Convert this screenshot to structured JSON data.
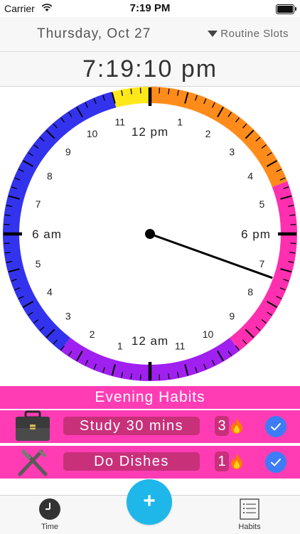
{
  "status_bar": {
    "carrier": "Carrier",
    "time": "7:19 PM"
  },
  "header": {
    "date": "Thursday, Oct 27",
    "routine_label": "Routine Slots"
  },
  "clock": {
    "digital_time": "7:19:10 pm",
    "labels": {
      "top": "12 pm",
      "bottom": "12 am",
      "left": "6 am",
      "right": "6 pm"
    },
    "hour_numbers": [
      "11",
      "1",
      "2",
      "3",
      "4",
      "5",
      "7",
      "8",
      "9",
      "10",
      "11",
      "1",
      "2",
      "3",
      "4",
      "5",
      "7",
      "8",
      "9",
      "10"
    ],
    "hand_minutes_from_midnight": 1159,
    "colors": {
      "blue": "#3333ee",
      "yellow": "#ffe81a",
      "orange": "#ff8c1a",
      "magenta": "#ff2fb0",
      "purple": "#a020f0"
    }
  },
  "habits": {
    "section_title": "Evening Habits",
    "accent_color": "#ff3cb4",
    "items": [
      {
        "name": "Study 30 mins",
        "streak": "3",
        "icon": "briefcase-icon",
        "completed": true
      },
      {
        "name": "Do Dishes",
        "streak": "1",
        "icon": "utensils-icon",
        "completed": true
      }
    ]
  },
  "tabbar": {
    "tabs": [
      {
        "label": "Time",
        "icon": "clock-icon"
      },
      {
        "label": "Habits",
        "icon": "list-icon"
      }
    ],
    "add_label": "+"
  }
}
